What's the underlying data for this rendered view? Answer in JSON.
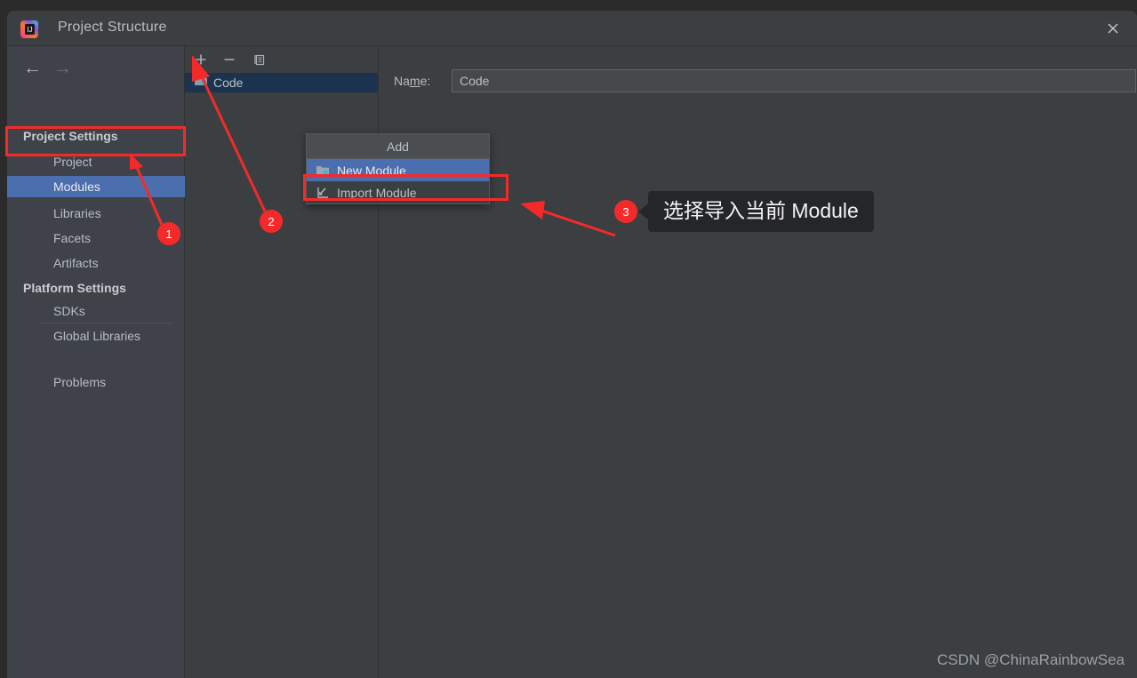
{
  "window": {
    "title": "Project Structure",
    "logo_icon": "intellij-idea-logo",
    "close_icon": "close-icon"
  },
  "sidebar": {
    "back_icon": "arrow-left-icon",
    "forward_icon": "arrow-right-icon",
    "groups": [
      {
        "label": "Project Settings",
        "items": [
          {
            "label": "Project",
            "selected": false
          },
          {
            "label": "Modules",
            "selected": true
          },
          {
            "label": "Libraries",
            "selected": false
          },
          {
            "label": "Facets",
            "selected": false
          },
          {
            "label": "Artifacts",
            "selected": false
          }
        ]
      },
      {
        "label": "Platform Settings",
        "items": [
          {
            "label": "SDKs",
            "selected": false
          },
          {
            "label": "Global Libraries",
            "selected": false
          }
        ]
      }
    ],
    "extra_items": [
      {
        "label": "Problems",
        "selected": false
      }
    ]
  },
  "modules_panel": {
    "toolbar": [
      {
        "name": "add-module-button",
        "icon": "plus-icon",
        "glyph": "+"
      },
      {
        "name": "remove-module-button",
        "icon": "minus-icon",
        "glyph": "−"
      },
      {
        "name": "copy-module-button",
        "icon": "copy-icon",
        "glyph": "❐"
      }
    ],
    "tree": [
      {
        "label": "Code",
        "icon": "module-folder-icon",
        "selected": true
      }
    ]
  },
  "detail": {
    "name_label_prefix": "Na",
    "name_label_mnemonic": "m",
    "name_label_suffix": "e:",
    "name_value": "Code",
    "name_placeholder": ""
  },
  "add_popup": {
    "header": "Add",
    "items": [
      {
        "label": "New Module",
        "icon": "new-module-folder-icon",
        "highlighted": true
      },
      {
        "label": "Import Module",
        "icon": "import-module-arrow-icon",
        "highlighted": false
      }
    ]
  },
  "annotations": {
    "accent_color": "#f42a2a",
    "markers": [
      {
        "number": "1"
      },
      {
        "number": "2"
      },
      {
        "number": "3"
      }
    ],
    "callout_text": "选择导入当前 Module"
  },
  "watermark": {
    "text": "CSDN @ChinaRainbowSea"
  }
}
